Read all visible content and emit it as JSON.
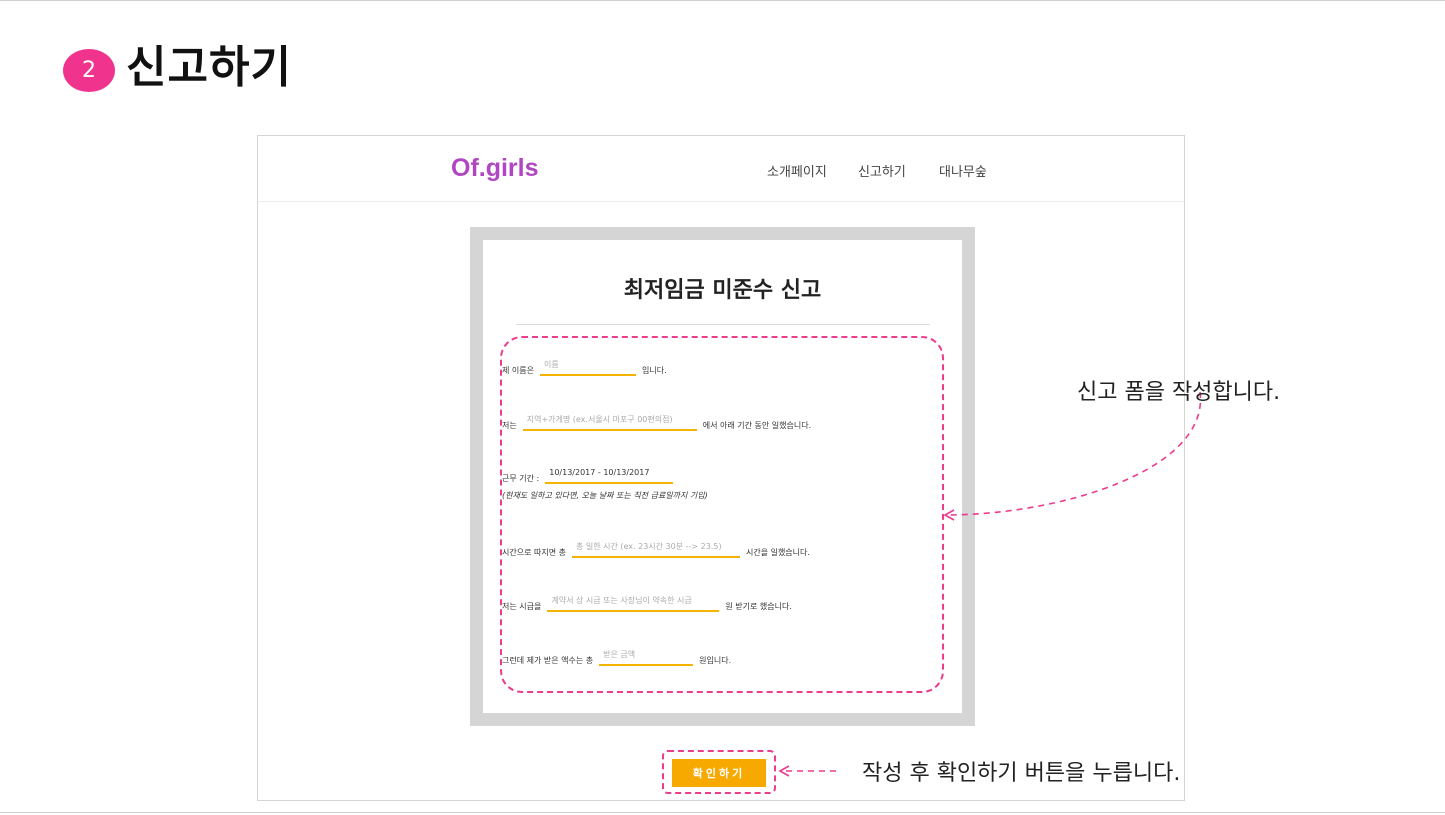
{
  "slide": {
    "step_number": "2",
    "title": "신고하기"
  },
  "navbar": {
    "brand": "Of.girls",
    "links": [
      "소개페이지",
      "신고하기",
      "대나무숲"
    ]
  },
  "form": {
    "title": "최저임금 미준수 신고",
    "rows": [
      {
        "before": "제 이름은",
        "placeholder": "이름",
        "after": "입니다."
      },
      {
        "before": "저는",
        "placeholder": "지역+가게명 (ex.서울시 마포구 00편의점)",
        "after": "에서 아래 기간 동안 일했습니다."
      },
      {
        "before": "근무 기간 :",
        "value": "10/13/2017 - 10/13/2017",
        "after": ""
      },
      {
        "before": "시간으로 따지면 총",
        "placeholder": "총 일한 시간 (ex. 23시간 30분 --> 23.5)",
        "after": "시간을 일했습니다."
      },
      {
        "before": "저는 시급을",
        "placeholder": "계약서 상 시급 또는 사장님이 약속한 시급",
        "after": "원 받기로 했습니다."
      },
      {
        "before": "그런데 제가 받은 액수는 총",
        "placeholder": "받은 금액",
        "after": "원입니다."
      }
    ],
    "period_note": "(현재도 일하고 있다면, 오늘 날짜 또는 직전 급료일까지 기입)",
    "submit_label": "확인하기"
  },
  "annotations": {
    "form_note": "신고 폼을 작성합니다.",
    "button_note": "작성 후 확인하기 버튼을 누릅니다."
  },
  "colors": {
    "badge": "#f0348e",
    "brand": "#b146c2",
    "field_underline": "#f4b400",
    "button": "#f8a900",
    "dashed_annotation": "#ec3c8e",
    "form_frame": "#d6d5d6"
  }
}
